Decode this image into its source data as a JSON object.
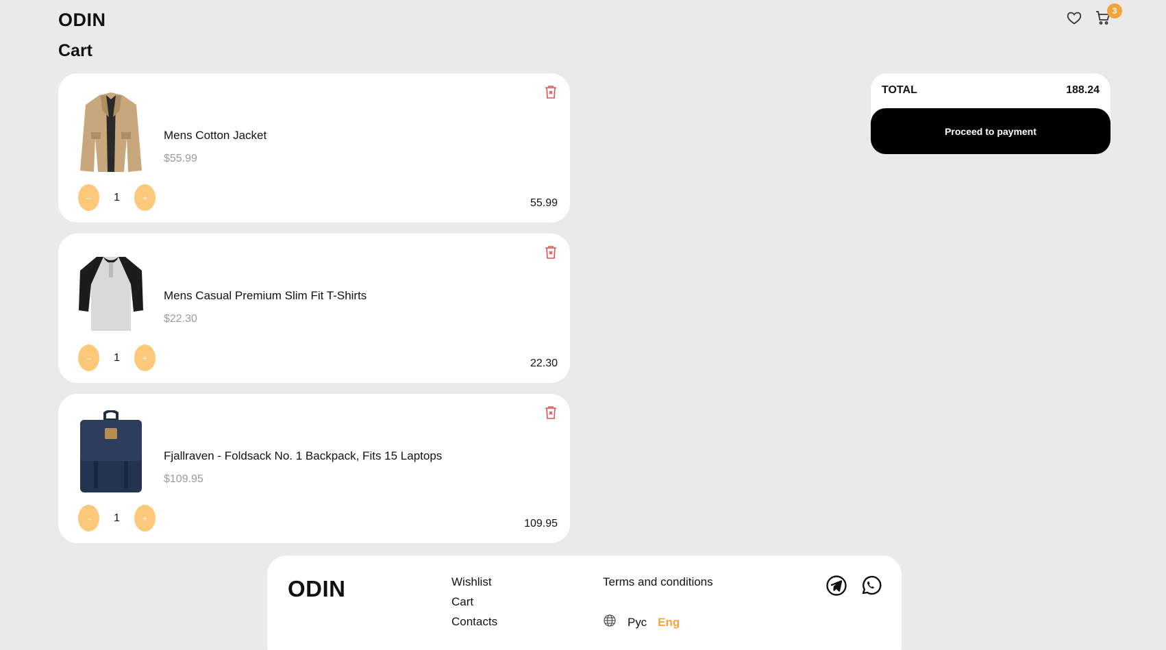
{
  "header": {
    "logo": "ODIN",
    "page_title": "Cart",
    "cart_badge_count": "3",
    "icons": [
      "heart-icon",
      "cart-icon"
    ]
  },
  "cart": {
    "items": [
      {
        "title": "Mens Cotton Jacket",
        "price": "$55.99",
        "quantity": "1",
        "line_total": "55.99",
        "image": "jacket-image",
        "minus": "–",
        "plus": "+"
      },
      {
        "title": "Mens Casual Premium Slim Fit T-Shirts",
        "price": "$22.30",
        "quantity": "1",
        "line_total": "22.30",
        "image": "tshirt-image",
        "minus": "–",
        "plus": "+"
      },
      {
        "title": "Fjallraven - Foldsack No. 1 Backpack, Fits 15 Laptops",
        "price": "$109.95",
        "quantity": "1",
        "line_total": "109.95",
        "image": "backpack-image",
        "minus": "–",
        "plus": "+"
      }
    ]
  },
  "summary": {
    "total_label": "TOTAL",
    "total_value": "188.24",
    "pay_label": "Proceed to payment"
  },
  "footer": {
    "logo": "ODIN",
    "links": [
      "Wishlist",
      "Cart",
      "Contacts"
    ],
    "terms": "Terms and conditions",
    "lang_ru": "Рус",
    "lang_en": "Eng",
    "active_lang": "Eng",
    "socials": [
      "telegram-icon",
      "whatsapp-icon"
    ]
  },
  "colors": {
    "background": "#eaeaea",
    "accent": "#f4a43a",
    "qty_button": "#fcc97a",
    "delete": "#e05050",
    "price_muted": "#9a9a9a"
  }
}
